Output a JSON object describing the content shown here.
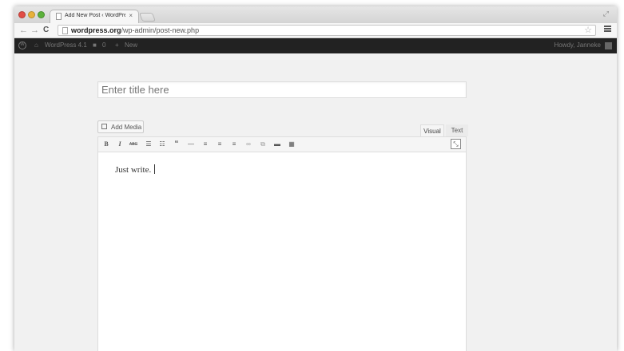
{
  "browser": {
    "tab_title": "Add New Post ‹ WordPress",
    "tab_close": "×",
    "url_host": "wordpress.org",
    "url_path": "/wp-admin/post-new.php",
    "colors": {
      "close": "#e24d45",
      "minimize": "#e8b23a",
      "maximize": "#5bb13a"
    }
  },
  "admin_bar": {
    "site_name": "WordPress 4.1",
    "comments_count": "0",
    "new_label": "New",
    "greeting": "Howdy, Janneke"
  },
  "editor": {
    "title_placeholder": "Enter title here",
    "add_media_label": "Add Media",
    "tab_visual": "Visual",
    "tab_text": "Text",
    "content": "Just write.",
    "toolbar_icons": [
      "bold-icon",
      "italic-icon",
      "strikethrough-icon",
      "bullet-list-icon",
      "numbered-list-icon",
      "blockquote-icon",
      "horizontal-rule-icon",
      "align-left-icon",
      "align-center-icon",
      "align-right-icon",
      "link-icon",
      "unlink-icon",
      "read-more-icon",
      "toolbar-toggle-icon"
    ]
  }
}
